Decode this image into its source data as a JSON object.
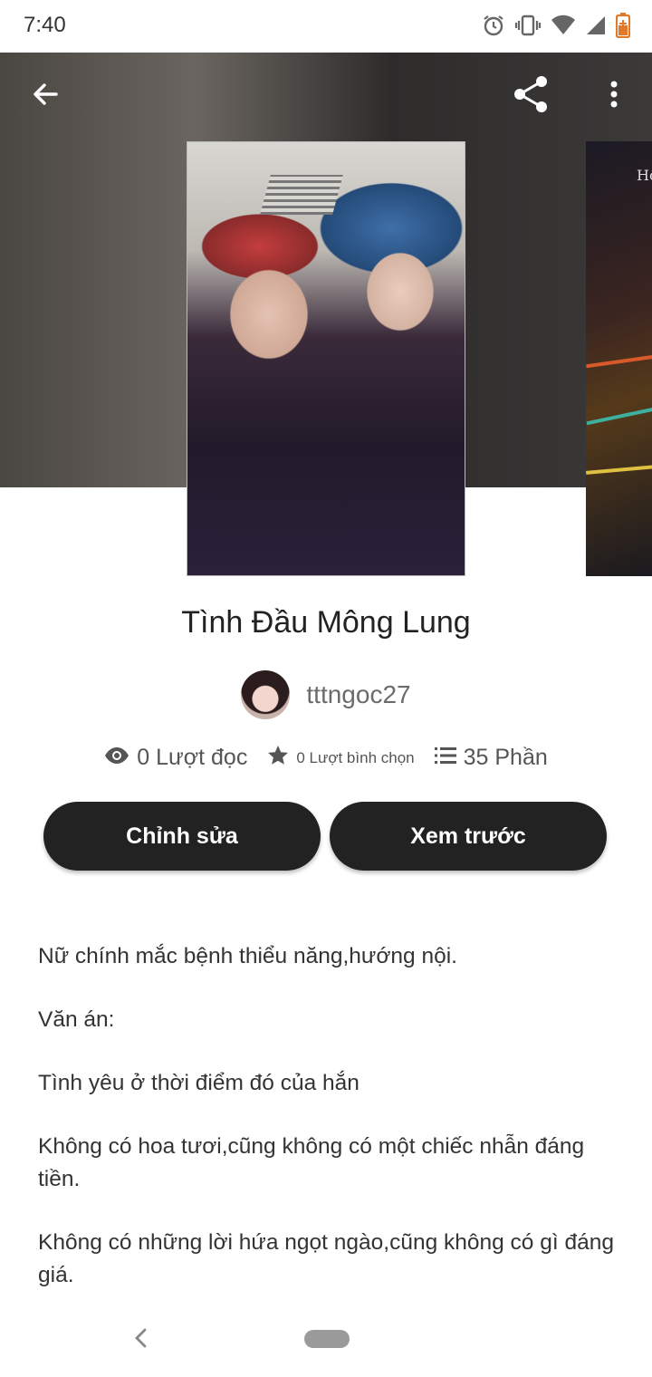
{
  "status_bar": {
    "time": "7:40",
    "icons": [
      "alarm-icon",
      "vibrate-icon",
      "wifi-icon",
      "signal-icon",
      "battery-icon"
    ]
  },
  "toolbar": {
    "back_icon": "arrow-left-icon",
    "share_icon": "share-icon",
    "more_icon": "more-vertical-icon"
  },
  "story": {
    "title": "Tình Đầu Mông Lung",
    "author": "tttngoc27",
    "next_cover_text": "Hồ"
  },
  "stats": {
    "reads": "0 Lượt đọc",
    "votes": "0 Lượt bình chọn",
    "parts": "35 Phần"
  },
  "buttons": {
    "edit": "Chỉnh sửa",
    "preview": "Xem trước"
  },
  "description": {
    "p1": "Nữ chính mắc bệnh thiểu năng,hướng nội.",
    "p2": "Văn án:",
    "p3": "Tình yêu ở thời điểm đó của hắn",
    "p4": "Không có hoa tươi,cũng không có một chiếc nhẫn đáng tiền.",
    "p5": "Không có những lời hứa ngọt ngào,cũng không có gì đáng giá."
  },
  "colors": {
    "button_bg": "#222222",
    "button_text": "#ffffff",
    "text_muted": "#6b6b6b"
  }
}
